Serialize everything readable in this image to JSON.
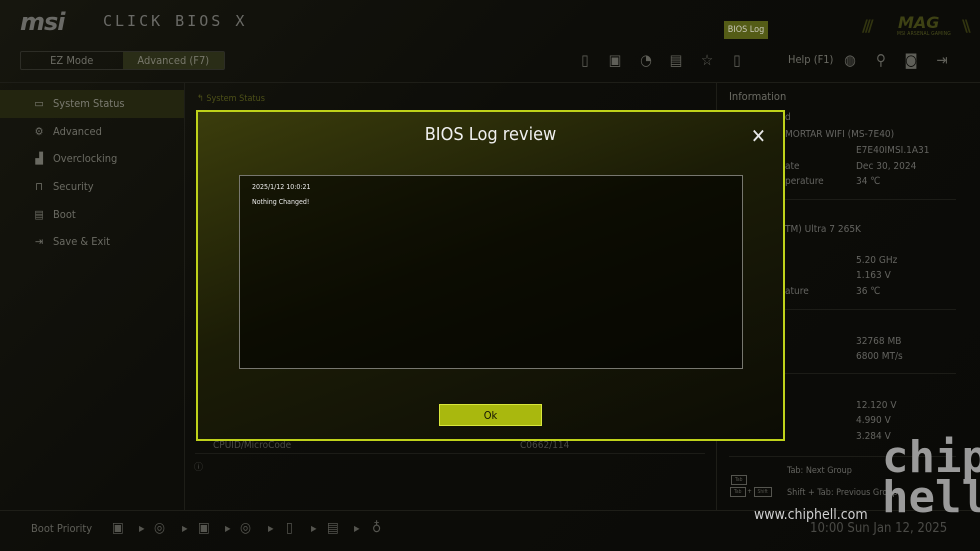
{
  "header": {
    "brand": "msi",
    "title": "CLICK BIOS X",
    "ez_mode": "EZ Mode",
    "advanced": "Advanced (F7)",
    "bios_log": "BIOS Log",
    "help": "Help (F1)",
    "mag_logo": "MAG",
    "mag_sub": "MSI ARSENAL GAMING"
  },
  "sidebar": {
    "items": [
      {
        "label": "System Status",
        "icon": "monitor-icon"
      },
      {
        "label": "Advanced",
        "icon": "gear-icon"
      },
      {
        "label": "Overclocking",
        "icon": "chart-icon"
      },
      {
        "label": "Security",
        "icon": "lock-icon"
      },
      {
        "label": "Boot",
        "icon": "drive-icon"
      },
      {
        "label": "Save & Exit",
        "icon": "exit-icon"
      }
    ]
  },
  "main": {
    "breadcrumb": "System Status",
    "row": {
      "label": "CPUID/MicroCode",
      "value": "C0662/114"
    }
  },
  "info": {
    "title": "Information",
    "board": {
      "label_fragment": "d",
      "name": "MORTAR WIFI (MS-7E40)",
      "bios": "E7E40IMSI.1A31",
      "date_label": "ate",
      "date": "Dec 30, 2024",
      "temp_label": "perature",
      "temp": "34 ℃"
    },
    "cpu": {
      "name": "TM) Ultra 7 265K",
      "freq": "5.20 GHz",
      "volt": "1.163 V",
      "temp_label": "ature",
      "temp": "36 ℃"
    },
    "memory": {
      "size": "32768 MB",
      "speed": "6800 MT/s"
    },
    "voltages": [
      "12.120 V",
      "4.990 V",
      "3.284 V"
    ],
    "hints": [
      {
        "keys": [
          "Tab"
        ],
        "text": "Tab: Next Group"
      },
      {
        "keys": [
          "Tab",
          "Shift"
        ],
        "text": "Shift + Tab: Previous Group"
      }
    ]
  },
  "footer": {
    "boot_priority": "Boot Priority",
    "datetime": "10:00  Sun Jan 12, 2025",
    "watermark": "www.chiphell.com",
    "watermark_logo": "chiphell"
  },
  "modal": {
    "title": "BIOS Log review",
    "log": [
      "2025/1/12 10:0:21",
      "Nothing Changed!"
    ],
    "ok": "Ok"
  },
  "colors": {
    "accent": "#bfd21a",
    "button": "#a9b80e"
  }
}
